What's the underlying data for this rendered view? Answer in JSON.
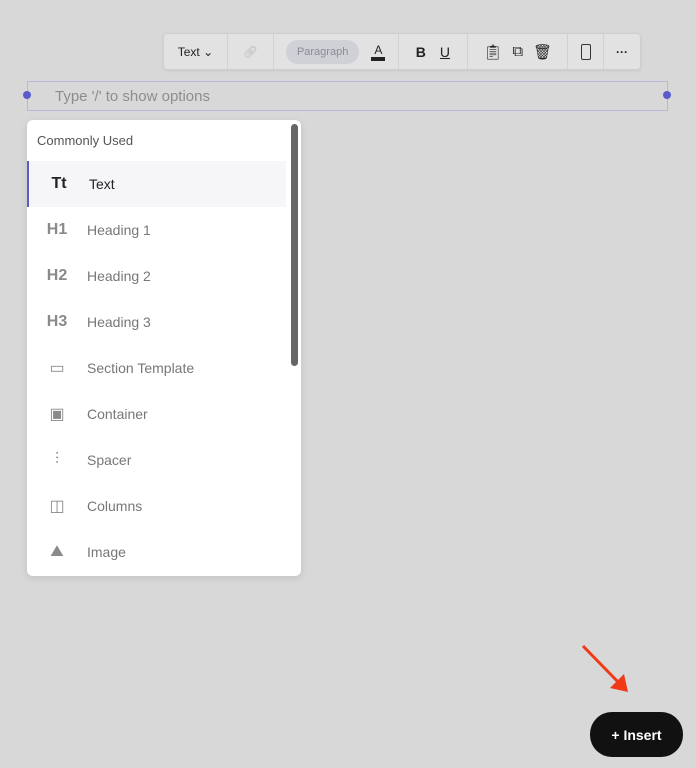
{
  "toolbar": {
    "type": "Text",
    "style": "Paragraph",
    "color_letter": "A",
    "bold": "B",
    "underline": "U"
  },
  "editor": {
    "placeholder": "Type '/' to show options"
  },
  "menu": {
    "section": "Commonly Used",
    "items": [
      {
        "icon": "Tt",
        "label": "Text"
      },
      {
        "icon": "H1",
        "label": "Heading 1"
      },
      {
        "icon": "H2",
        "label": "Heading 2"
      },
      {
        "icon": "H3",
        "label": "Heading 3"
      },
      {
        "icon": "section-template-icon",
        "label": "Section Template"
      },
      {
        "icon": "container-icon",
        "label": "Container"
      },
      {
        "icon": "spacer-icon",
        "label": "Spacer"
      },
      {
        "icon": "columns-icon",
        "label": "Columns"
      },
      {
        "icon": "image-icon",
        "label": "Image"
      }
    ]
  },
  "insert": {
    "label": "+ Insert"
  },
  "colors": {
    "accent": "#5b5bd0",
    "arrow": "#f03a17"
  }
}
